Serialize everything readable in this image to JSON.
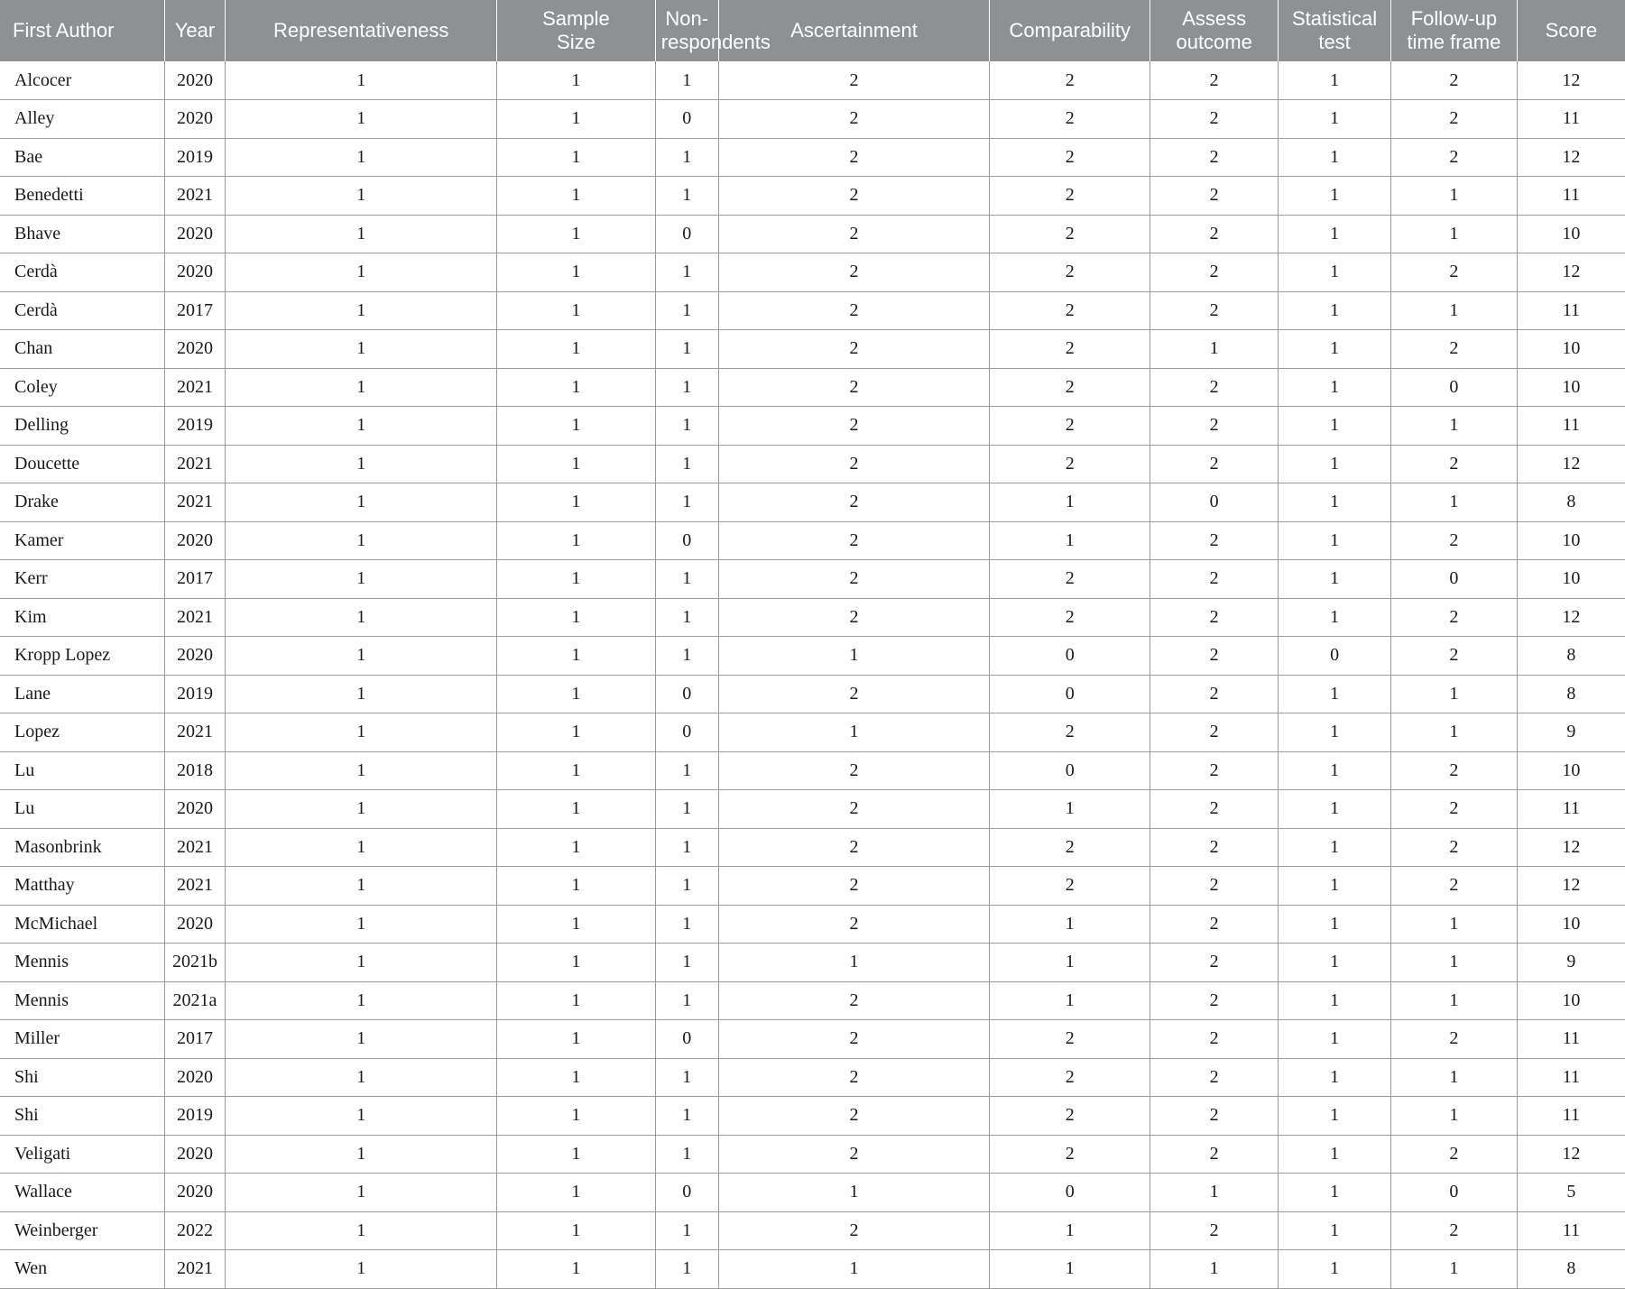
{
  "table": {
    "columns": [
      {
        "key": "first_author",
        "label": "First Author"
      },
      {
        "key": "year",
        "label": "Year"
      },
      {
        "key": "representativeness",
        "label": "Representativeness"
      },
      {
        "key": "sample_size",
        "label": "Sample\nSize"
      },
      {
        "key": "non_respondents",
        "label": "Non-\nrespondents"
      },
      {
        "key": "ascertainment",
        "label": "Ascertainment"
      },
      {
        "key": "comparability",
        "label": "Comparability"
      },
      {
        "key": "assess_outcome",
        "label": "Assess\noutcome"
      },
      {
        "key": "statistical_test",
        "label": "Statistical\ntest"
      },
      {
        "key": "follow_up_time_frame",
        "label": "Follow-up\ntime frame"
      },
      {
        "key": "score",
        "label": "Score"
      }
    ],
    "header_labels": {
      "first_author": "First Author",
      "year": "Year",
      "representativeness": "Representativeness",
      "sample_size_line1": "Sample",
      "sample_size_line2": "Size",
      "non_respondents_line1": "Non-",
      "non_respondents_line2": "respondents",
      "ascertainment": "Ascertainment",
      "comparability": "Comparability",
      "assess_outcome_line1": "Assess",
      "assess_outcome_line2": "outcome",
      "statistical_test_line1": "Statistical",
      "statistical_test_line2": "test",
      "follow_up_line1": "Follow-up",
      "follow_up_line2": "time frame",
      "score": "Score"
    },
    "colors": {
      "header_background": "#8d9194",
      "header_text": "#ffffff",
      "cell_text": "#1a1a1a",
      "grid_line": "#9a9a9a",
      "cell_background": "#ffffff"
    },
    "rows": [
      {
        "first_author": "Alcocer",
        "year": "2020",
        "representativeness": "1",
        "sample_size": "1",
        "non_respondents": "1",
        "ascertainment": "2",
        "comparability": "2",
        "assess_outcome": "2",
        "statistical_test": "1",
        "follow_up_time_frame": "2",
        "score": "12"
      },
      {
        "first_author": "Alley",
        "year": "2020",
        "representativeness": "1",
        "sample_size": "1",
        "non_respondents": "0",
        "ascertainment": "2",
        "comparability": "2",
        "assess_outcome": "2",
        "statistical_test": "1",
        "follow_up_time_frame": "2",
        "score": "11"
      },
      {
        "first_author": "Bae",
        "year": "2019",
        "representativeness": "1",
        "sample_size": "1",
        "non_respondents": "1",
        "ascertainment": "2",
        "comparability": "2",
        "assess_outcome": "2",
        "statistical_test": "1",
        "follow_up_time_frame": "2",
        "score": "12"
      },
      {
        "first_author": "Benedetti",
        "year": "2021",
        "representativeness": "1",
        "sample_size": "1",
        "non_respondents": "1",
        "ascertainment": "2",
        "comparability": "2",
        "assess_outcome": "2",
        "statistical_test": "1",
        "follow_up_time_frame": "1",
        "score": "11"
      },
      {
        "first_author": "Bhave",
        "year": "2020",
        "representativeness": "1",
        "sample_size": "1",
        "non_respondents": "0",
        "ascertainment": "2",
        "comparability": "2",
        "assess_outcome": "2",
        "statistical_test": "1",
        "follow_up_time_frame": "1",
        "score": "10"
      },
      {
        "first_author": "Cerdà",
        "year": "2020",
        "representativeness": "1",
        "sample_size": "1",
        "non_respondents": "1",
        "ascertainment": "2",
        "comparability": "2",
        "assess_outcome": "2",
        "statistical_test": "1",
        "follow_up_time_frame": "2",
        "score": "12"
      },
      {
        "first_author": "Cerdà",
        "year": "2017",
        "representativeness": "1",
        "sample_size": "1",
        "non_respondents": "1",
        "ascertainment": "2",
        "comparability": "2",
        "assess_outcome": "2",
        "statistical_test": "1",
        "follow_up_time_frame": "1",
        "score": "11"
      },
      {
        "first_author": "Chan",
        "year": "2020",
        "representativeness": "1",
        "sample_size": "1",
        "non_respondents": "1",
        "ascertainment": "2",
        "comparability": "2",
        "assess_outcome": "1",
        "statistical_test": "1",
        "follow_up_time_frame": "2",
        "score": "10"
      },
      {
        "first_author": "Coley",
        "year": "2021",
        "representativeness": "1",
        "sample_size": "1",
        "non_respondents": "1",
        "ascertainment": "2",
        "comparability": "2",
        "assess_outcome": "2",
        "statistical_test": "1",
        "follow_up_time_frame": "0",
        "score": "10"
      },
      {
        "first_author": "Delling",
        "year": "2019",
        "representativeness": "1",
        "sample_size": "1",
        "non_respondents": "1",
        "ascertainment": "2",
        "comparability": "2",
        "assess_outcome": "2",
        "statistical_test": "1",
        "follow_up_time_frame": "1",
        "score": "11"
      },
      {
        "first_author": "Doucette",
        "year": "2021",
        "representativeness": "1",
        "sample_size": "1",
        "non_respondents": "1",
        "ascertainment": "2",
        "comparability": "2",
        "assess_outcome": "2",
        "statistical_test": "1",
        "follow_up_time_frame": "2",
        "score": "12"
      },
      {
        "first_author": "Drake",
        "year": "2021",
        "representativeness": "1",
        "sample_size": "1",
        "non_respondents": "1",
        "ascertainment": "2",
        "comparability": "1",
        "assess_outcome": "0",
        "statistical_test": "1",
        "follow_up_time_frame": "1",
        "score": "8"
      },
      {
        "first_author": "Kamer",
        "year": "2020",
        "representativeness": "1",
        "sample_size": "1",
        "non_respondents": "0",
        "ascertainment": "2",
        "comparability": "1",
        "assess_outcome": "2",
        "statistical_test": "1",
        "follow_up_time_frame": "2",
        "score": "10"
      },
      {
        "first_author": "Kerr",
        "year": "2017",
        "representativeness": "1",
        "sample_size": "1",
        "non_respondents": "1",
        "ascertainment": "2",
        "comparability": "2",
        "assess_outcome": "2",
        "statistical_test": "1",
        "follow_up_time_frame": "0",
        "score": "10"
      },
      {
        "first_author": "Kim",
        "year": "2021",
        "representativeness": "1",
        "sample_size": "1",
        "non_respondents": "1",
        "ascertainment": "2",
        "comparability": "2",
        "assess_outcome": "2",
        "statistical_test": "1",
        "follow_up_time_frame": "2",
        "score": "12"
      },
      {
        "first_author": "Kropp Lopez",
        "year": "2020",
        "representativeness": "1",
        "sample_size": "1",
        "non_respondents": "1",
        "ascertainment": "1",
        "comparability": "0",
        "assess_outcome": "2",
        "statistical_test": "0",
        "follow_up_time_frame": "2",
        "score": "8"
      },
      {
        "first_author": "Lane",
        "year": "2019",
        "representativeness": "1",
        "sample_size": "1",
        "non_respondents": "0",
        "ascertainment": "2",
        "comparability": "0",
        "assess_outcome": "2",
        "statistical_test": "1",
        "follow_up_time_frame": "1",
        "score": "8"
      },
      {
        "first_author": "Lopez",
        "year": "2021",
        "representativeness": "1",
        "sample_size": "1",
        "non_respondents": "0",
        "ascertainment": "1",
        "comparability": "2",
        "assess_outcome": "2",
        "statistical_test": "1",
        "follow_up_time_frame": "1",
        "score": "9"
      },
      {
        "first_author": "Lu",
        "year": "2018",
        "representativeness": "1",
        "sample_size": "1",
        "non_respondents": "1",
        "ascertainment": "2",
        "comparability": "0",
        "assess_outcome": "2",
        "statistical_test": "1",
        "follow_up_time_frame": "2",
        "score": "10"
      },
      {
        "first_author": "Lu",
        "year": "2020",
        "representativeness": "1",
        "sample_size": "1",
        "non_respondents": "1",
        "ascertainment": "2",
        "comparability": "1",
        "assess_outcome": "2",
        "statistical_test": "1",
        "follow_up_time_frame": "2",
        "score": "11"
      },
      {
        "first_author": "Masonbrink",
        "year": "2021",
        "representativeness": "1",
        "sample_size": "1",
        "non_respondents": "1",
        "ascertainment": "2",
        "comparability": "2",
        "assess_outcome": "2",
        "statistical_test": "1",
        "follow_up_time_frame": "2",
        "score": "12"
      },
      {
        "first_author": "Matthay",
        "year": "2021",
        "representativeness": "1",
        "sample_size": "1",
        "non_respondents": "1",
        "ascertainment": "2",
        "comparability": "2",
        "assess_outcome": "2",
        "statistical_test": "1",
        "follow_up_time_frame": "2",
        "score": "12"
      },
      {
        "first_author": "McMichael",
        "year": "2020",
        "representativeness": "1",
        "sample_size": "1",
        "non_respondents": "1",
        "ascertainment": "2",
        "comparability": "1",
        "assess_outcome": "2",
        "statistical_test": "1",
        "follow_up_time_frame": "1",
        "score": "10"
      },
      {
        "first_author": "Mennis",
        "year": "2021b",
        "representativeness": "1",
        "sample_size": "1",
        "non_respondents": "1",
        "ascertainment": "1",
        "comparability": "1",
        "assess_outcome": "2",
        "statistical_test": "1",
        "follow_up_time_frame": "1",
        "score": "9"
      },
      {
        "first_author": "Mennis",
        "year": "2021a",
        "representativeness": "1",
        "sample_size": "1",
        "non_respondents": "1",
        "ascertainment": "2",
        "comparability": "1",
        "assess_outcome": "2",
        "statistical_test": "1",
        "follow_up_time_frame": "1",
        "score": "10"
      },
      {
        "first_author": "Miller",
        "year": "2017",
        "representativeness": "1",
        "sample_size": "1",
        "non_respondents": "0",
        "ascertainment": "2",
        "comparability": "2",
        "assess_outcome": "2",
        "statistical_test": "1",
        "follow_up_time_frame": "2",
        "score": "11"
      },
      {
        "first_author": "Shi",
        "year": "2020",
        "representativeness": "1",
        "sample_size": "1",
        "non_respondents": "1",
        "ascertainment": "2",
        "comparability": "2",
        "assess_outcome": "2",
        "statistical_test": "1",
        "follow_up_time_frame": "1",
        "score": "11"
      },
      {
        "first_author": "Shi",
        "year": "2019",
        "representativeness": "1",
        "sample_size": "1",
        "non_respondents": "1",
        "ascertainment": "2",
        "comparability": "2",
        "assess_outcome": "2",
        "statistical_test": "1",
        "follow_up_time_frame": "1",
        "score": "11"
      },
      {
        "first_author": "Veligati",
        "year": "2020",
        "representativeness": "1",
        "sample_size": "1",
        "non_respondents": "1",
        "ascertainment": "2",
        "comparability": "2",
        "assess_outcome": "2",
        "statistical_test": "1",
        "follow_up_time_frame": "2",
        "score": "12"
      },
      {
        "first_author": "Wallace",
        "year": "2020",
        "representativeness": "1",
        "sample_size": "1",
        "non_respondents": "0",
        "ascertainment": "1",
        "comparability": "0",
        "assess_outcome": "1",
        "statistical_test": "1",
        "follow_up_time_frame": "0",
        "score": "5"
      },
      {
        "first_author": "Weinberger",
        "year": "2022",
        "representativeness": "1",
        "sample_size": "1",
        "non_respondents": "1",
        "ascertainment": "2",
        "comparability": "1",
        "assess_outcome": "2",
        "statistical_test": "1",
        "follow_up_time_frame": "2",
        "score": "11"
      },
      {
        "first_author": "Wen",
        "year": "2021",
        "representativeness": "1",
        "sample_size": "1",
        "non_respondents": "1",
        "ascertainment": "1",
        "comparability": "1",
        "assess_outcome": "1",
        "statistical_test": "1",
        "follow_up_time_frame": "1",
        "score": "8"
      }
    ]
  }
}
